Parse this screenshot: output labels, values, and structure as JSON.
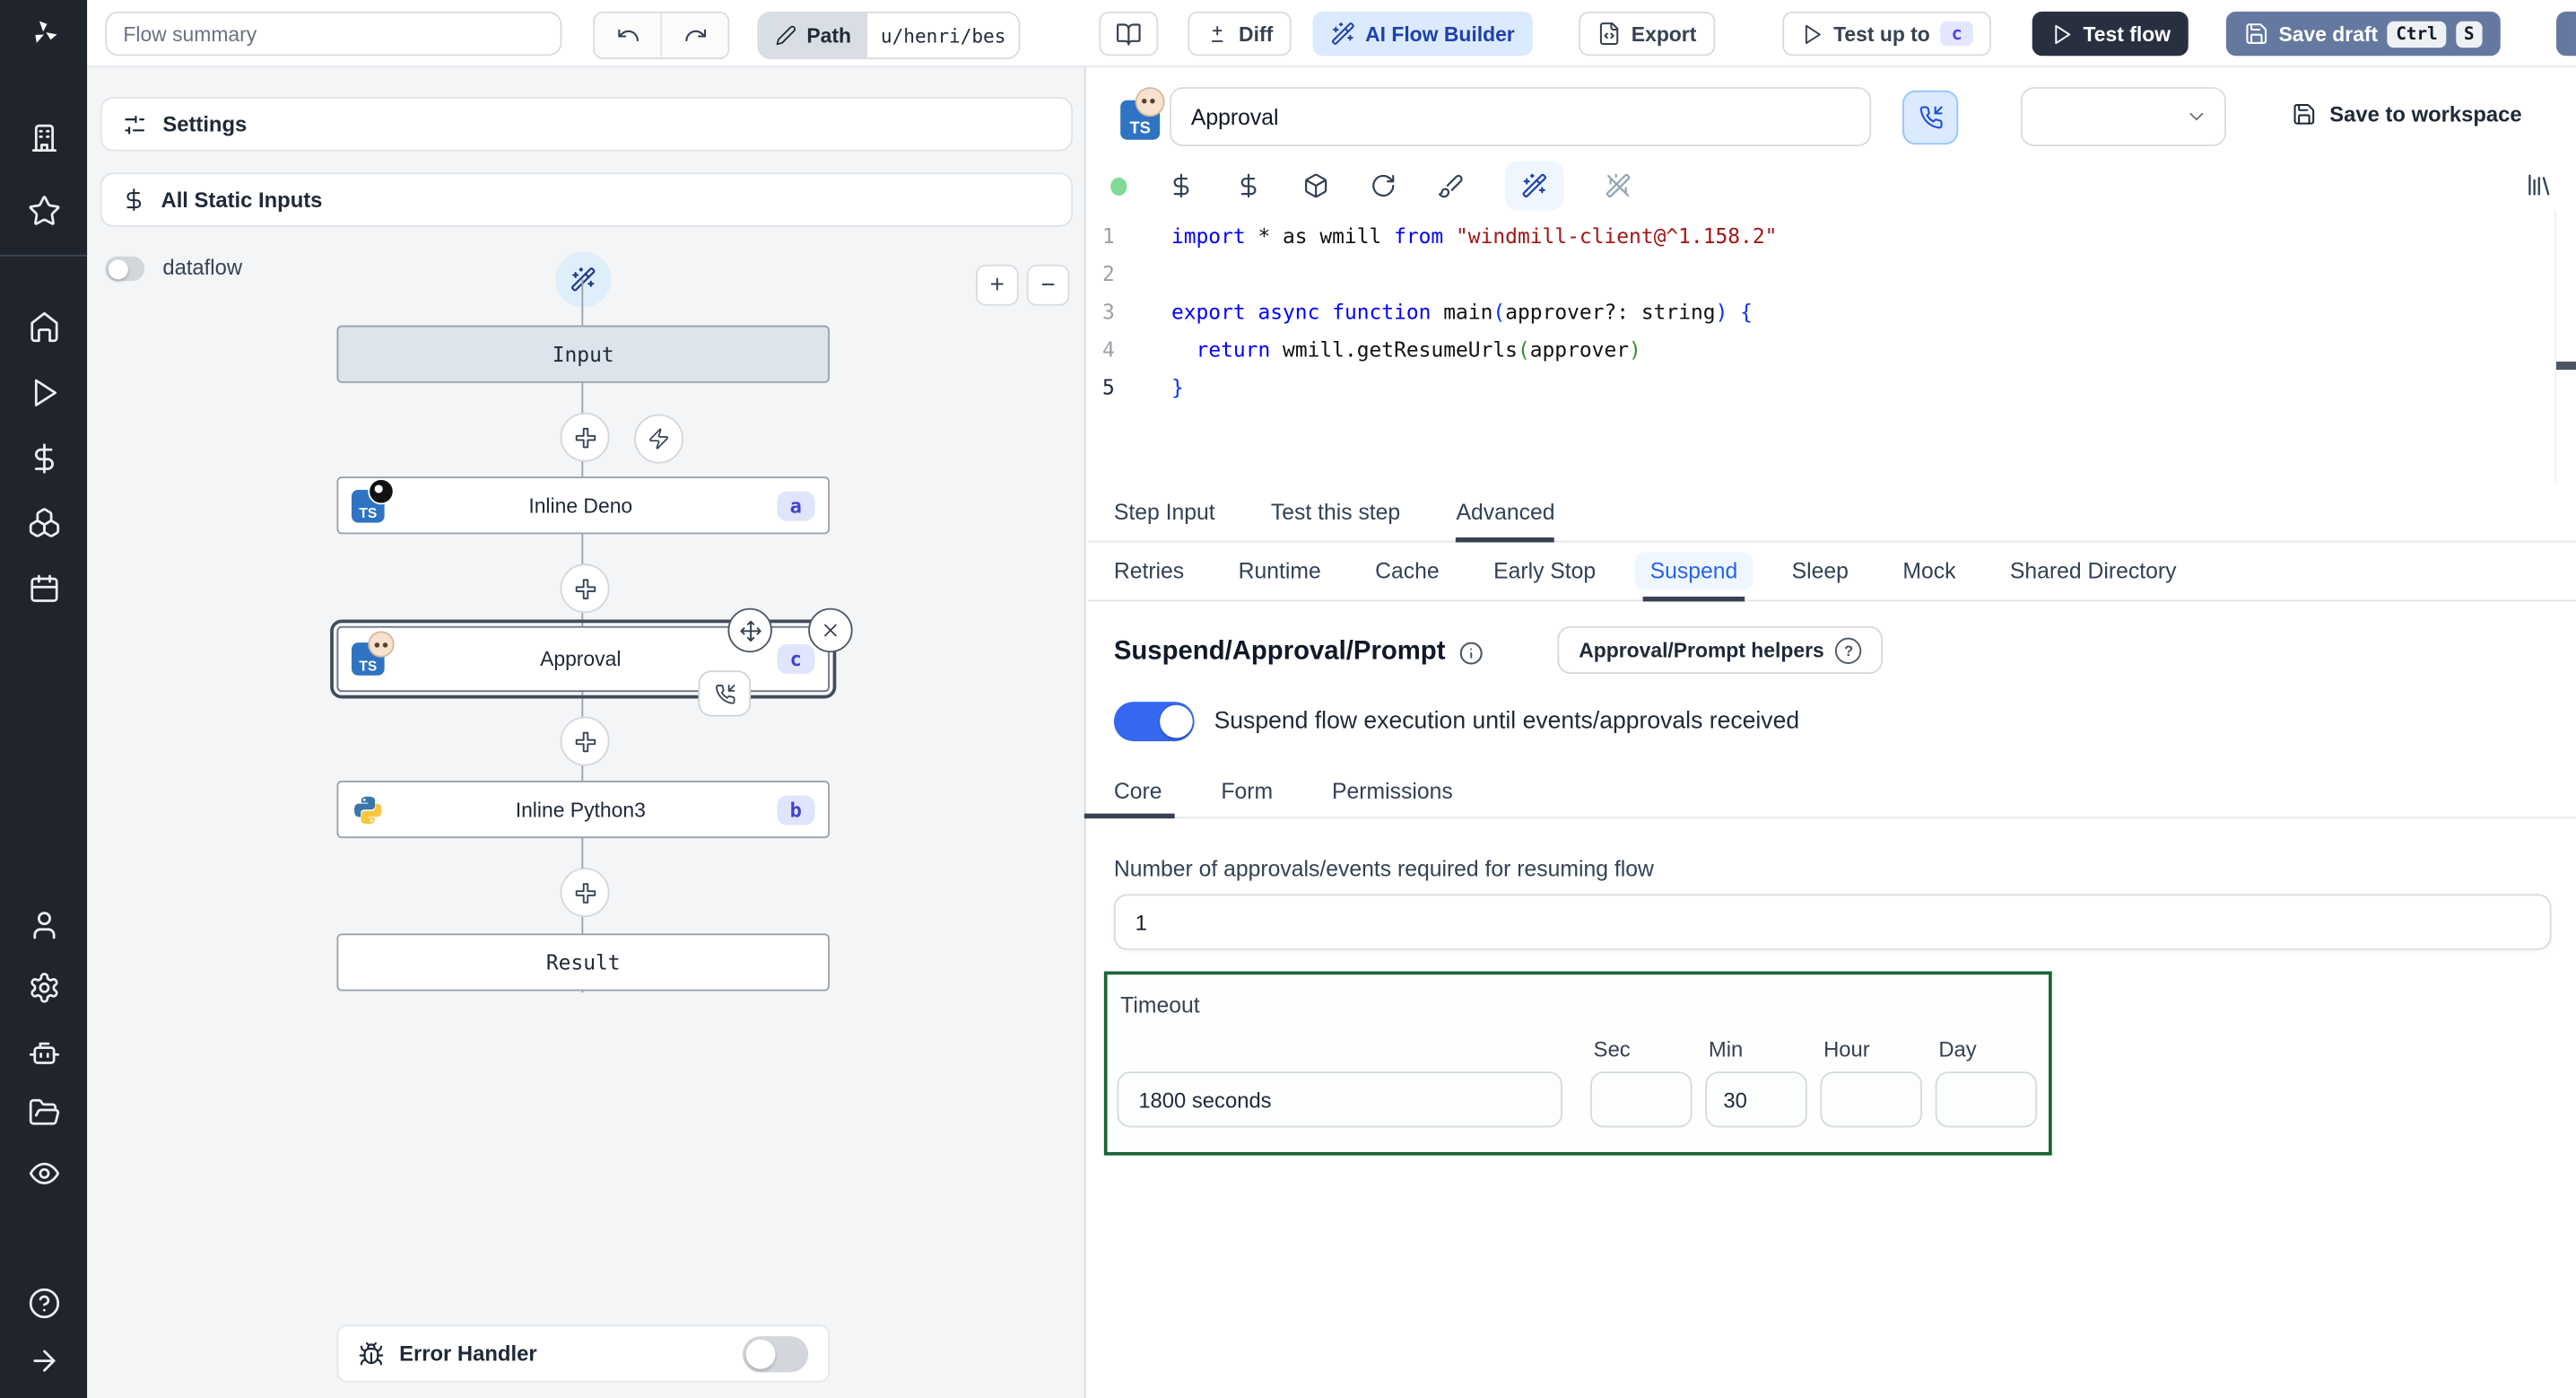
{
  "colors": {
    "accent_blue": "#2563eb",
    "toggle_on": "#3568ee",
    "rail_bg": "#20242c",
    "timeout_border": "#186534",
    "save_draft": "#6579a0",
    "test_flow": "#283040",
    "ai_builder_bg": "#dbeafe"
  },
  "topbar": {
    "flow_summary_placeholder": "Flow summary",
    "path_label": "Path",
    "path_value": "u/henri/bes",
    "diff_label": "Diff",
    "ai_label": "AI Flow Builder",
    "export_label": "Export",
    "test_up_to_label": "Test up to",
    "test_up_to_badge": "c",
    "test_flow_label": "Test flow",
    "save_draft_label": "Save draft",
    "kbd_ctrl": "Ctrl",
    "kbd_s": "S"
  },
  "flow_panel": {
    "settings_label": "Settings",
    "all_static_inputs_label": "All Static Inputs",
    "dataflow_label": "dataflow",
    "zoom_in": "+",
    "zoom_out": "−",
    "nodes": {
      "input": {
        "label": "Input"
      },
      "deno": {
        "label": "Inline Deno",
        "badge": "a"
      },
      "approval": {
        "label": "Approval",
        "badge": "c"
      },
      "python": {
        "label": "Inline Python3",
        "badge": "b"
      },
      "result": {
        "label": "Result"
      }
    },
    "error_handler_label": "Error Handler"
  },
  "icons": {
    "ts": "TS"
  },
  "step_header": {
    "name_value": "Approval",
    "save_to_workspace_label": "Save to workspace"
  },
  "editor": {
    "lines": [
      [
        {
          "t": "import",
          "c": "kw"
        },
        {
          "t": " * as wmill ",
          "c": "pl"
        },
        {
          "t": "from",
          "c": "kw"
        },
        {
          "t": " ",
          "c": "pl"
        },
        {
          "t": "\"windmill-client@^1.158.2\"",
          "c": "str"
        }
      ],
      [],
      [
        {
          "t": "export",
          "c": "kw"
        },
        {
          "t": " ",
          "c": "pl"
        },
        {
          "t": "async",
          "c": "kw"
        },
        {
          "t": " ",
          "c": "pl"
        },
        {
          "t": "function",
          "c": "kw"
        },
        {
          "t": " main",
          "c": "pl"
        },
        {
          "t": "(",
          "c": "b1"
        },
        {
          "t": "approver?: string",
          "c": "pl"
        },
        {
          "t": ")",
          "c": "b1"
        },
        {
          "t": " ",
          "c": "pl"
        },
        {
          "t": "{",
          "c": "b1"
        }
      ],
      [
        {
          "t": "  ",
          "c": "pl"
        },
        {
          "t": "return",
          "c": "kw"
        },
        {
          "t": " wmill.getResumeUrls",
          "c": "pl"
        },
        {
          "t": "(",
          "c": "b2"
        },
        {
          "t": "approver",
          "c": "pl"
        },
        {
          "t": ")",
          "c": "b2"
        }
      ],
      [
        {
          "t": "}",
          "c": "b1"
        }
      ]
    ]
  },
  "tabs": [
    "Step Input",
    "Test this step",
    "Advanced"
  ],
  "subtabs": [
    "Retries",
    "Runtime",
    "Cache",
    "Early Stop",
    "Suspend",
    "Sleep",
    "Mock",
    "Shared Directory"
  ],
  "suspend": {
    "heading": "Suspend/Approval/Prompt",
    "helpers_label": "Approval/Prompt helpers",
    "toggle_label": "Suspend flow execution until events/approvals received",
    "core_tabs": [
      "Core",
      "Form",
      "Permissions"
    ],
    "approvals_label": "Number of approvals/events required for resuming flow",
    "approvals_value": "1",
    "timeout_label": "Timeout",
    "timeout_value": "1800 seconds",
    "unit_labels": [
      "Sec",
      "Min",
      "Hour",
      "Day"
    ],
    "sec_value": "",
    "min_value": "30",
    "hour_value": "",
    "day_value": ""
  }
}
